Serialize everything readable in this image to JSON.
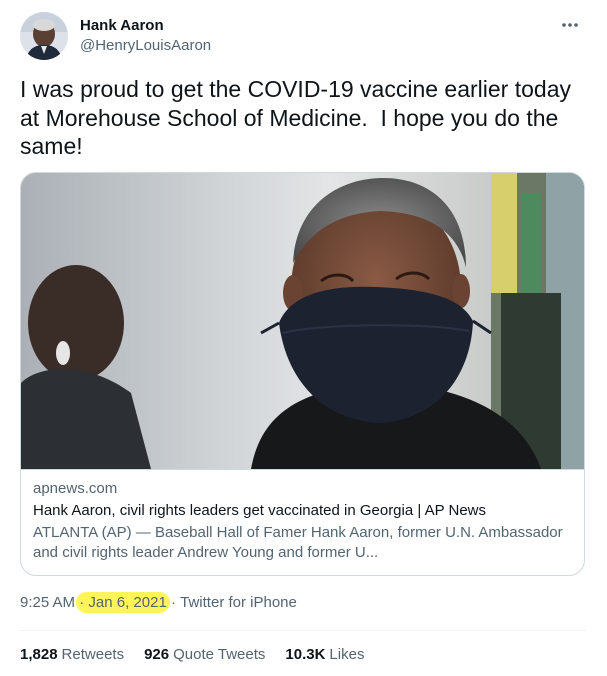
{
  "user": {
    "display_name": "Hank Aaron",
    "handle": "@HenryLouisAaron"
  },
  "icons": {
    "more": "more-horizontal-icon",
    "avatar": "profile-photo"
  },
  "tweet": {
    "text": "I was proud to get the COVID-19 vaccine earlier today\nat Morehouse School of Medicine.  I hope you do the\nsame!"
  },
  "card": {
    "domain": "apnews.com",
    "title": "Hank Aaron, civil rights leaders get vaccinated in Georgia | AP News",
    "description": "ATLANTA (AP) — Baseball Hall of Famer Hank Aaron, former U.N. Ambassador and civil rights leader Andrew Young and former U..."
  },
  "meta": {
    "time": "9:25 AM",
    "separator": "·",
    "date": "Jan 6, 2021",
    "source": "Twitter for iPhone"
  },
  "stats": {
    "retweets_count": "1,828",
    "retweets_label": "Retweets",
    "quotes_count": "926",
    "quotes_label": "Quote Tweets",
    "likes_count": "10.3K",
    "likes_label": "Likes"
  },
  "colors": {
    "text_primary": "#0f1419",
    "text_secondary": "#536471",
    "border": "#cfd9de",
    "highlight": "#fff45a"
  }
}
